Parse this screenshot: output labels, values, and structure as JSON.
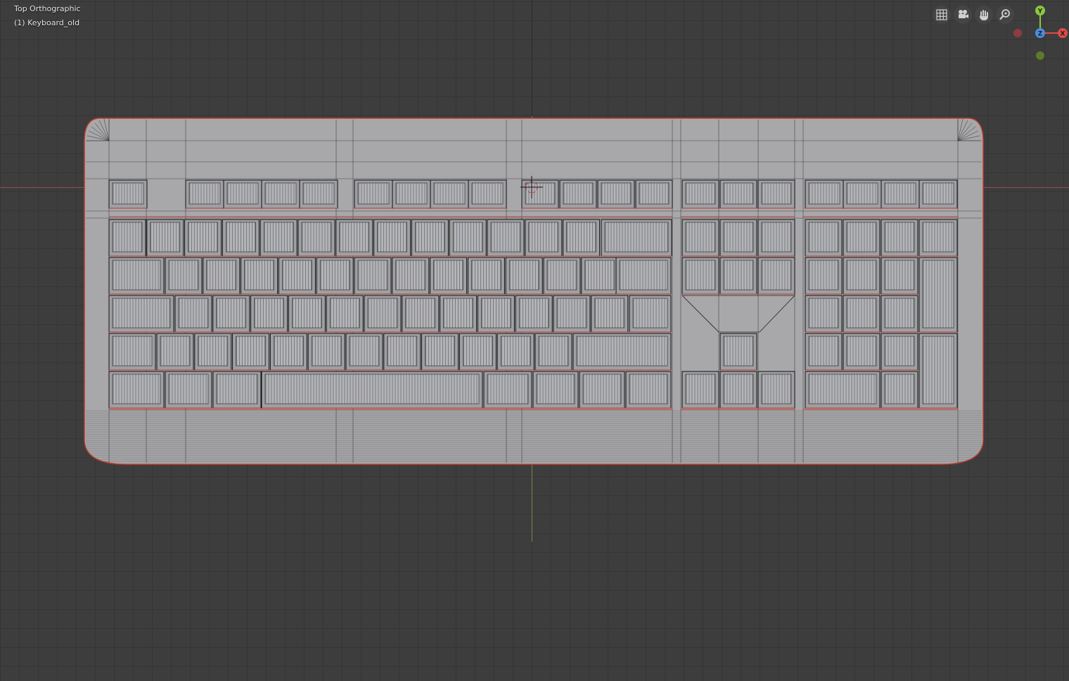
{
  "viewport": {
    "view_name": "Top Orthographic",
    "object_name": "(1) Keyboard_old",
    "colors": {
      "background": "#3d3d3d",
      "grid": "#353535",
      "x_axis": "#9a4a4a",
      "y_axis": "#74863c",
      "mesh_fill": "#a8a8ab",
      "wire": "#1a1a1a",
      "selection_outline": "#c0392b"
    }
  },
  "nav_tools": [
    {
      "name": "toggle-perspective-icon"
    },
    {
      "name": "camera-view-icon"
    },
    {
      "name": "pan-hand-icon"
    },
    {
      "name": "zoom-icon"
    }
  ],
  "gizmo": {
    "y_label": "Y",
    "x_label": "X",
    "z_label": "Z",
    "colors": {
      "x": "#e04a4a",
      "y": "#8dc63f",
      "z": "#4b8ede"
    }
  }
}
